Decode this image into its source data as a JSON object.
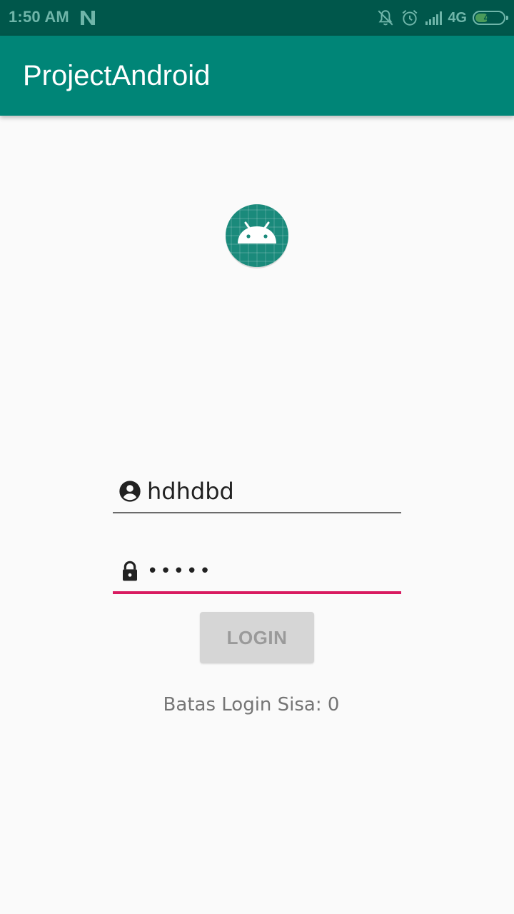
{
  "status_bar": {
    "time": "1:50 AM",
    "network": "4G",
    "battery_level": "47",
    "battery_fraction": 0.47,
    "icons": [
      "n-notification-icon",
      "bell-off-icon",
      "alarm-icon",
      "signal-icon",
      "battery-icon"
    ]
  },
  "app_bar": {
    "title": "ProjectAndroid"
  },
  "logo": {
    "icon": "android-robot-icon",
    "background_color": "#1a8a7b"
  },
  "form": {
    "username": {
      "icon": "account-circle-icon",
      "value": "hdhdbd"
    },
    "password": {
      "icon": "lock-icon",
      "value": "hdhdb"
    },
    "login_label": "LOGIN",
    "remaining_text": "Batas Login Sisa: 0"
  },
  "colors": {
    "status_bar": "#00574b",
    "app_bar": "#008577",
    "accent": "#d81b60",
    "background": "#fafafa"
  }
}
